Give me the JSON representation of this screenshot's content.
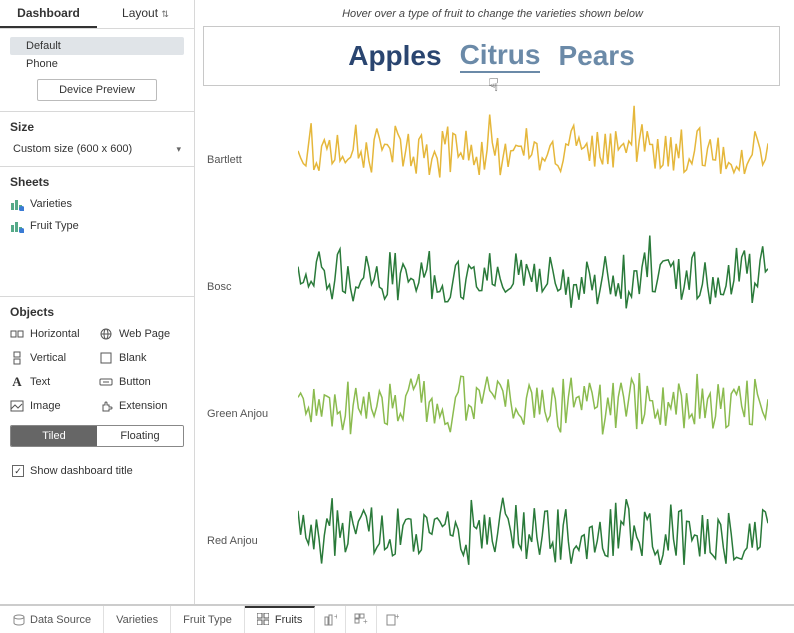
{
  "sidebar": {
    "tabs": {
      "dashboard": "Dashboard",
      "layout": "Layout"
    },
    "devices": [
      "Default",
      "Phone"
    ],
    "device_preview": "Device Preview",
    "size_title": "Size",
    "size_value": "Custom size (600 x 600)",
    "sheets_title": "Sheets",
    "sheets": [
      "Varieties",
      "Fruit Type"
    ],
    "objects_title": "Objects",
    "objects": {
      "horizontal": "Horizontal",
      "vertical": "Vertical",
      "text": "Text",
      "image": "Image",
      "webpage": "Web Page",
      "blank": "Blank",
      "button": "Button",
      "extension": "Extension"
    },
    "tiled": "Tiled",
    "floating": "Floating",
    "show_title": "Show dashboard title"
  },
  "main": {
    "hint": "Hover over a type of fruit to change the varieties shown below",
    "filters": [
      {
        "label": "Apples",
        "color": "#2a4570"
      },
      {
        "label": "Citrus",
        "color": "#6b8aa8",
        "underline": true
      },
      {
        "label": "Pears",
        "color": "#6b8aa8"
      }
    ]
  },
  "chart_data": [
    {
      "type": "line",
      "name": "Bartlett",
      "color": "#e5b73b",
      "n": 180,
      "baseline": 55,
      "amp": 22,
      "seed": 1
    },
    {
      "type": "line",
      "name": "Bosc",
      "color": "#2a7a3a",
      "n": 180,
      "baseline": 55,
      "amp": 25,
      "seed": 2
    },
    {
      "type": "line",
      "name": "Green Anjou",
      "color": "#8bbb4f",
      "n": 180,
      "baseline": 55,
      "amp": 25,
      "seed": 3
    },
    {
      "type": "line",
      "name": "Red Anjou",
      "color": "#2a7a3a",
      "n": 180,
      "baseline": 55,
      "amp": 28,
      "seed": 4
    }
  ],
  "bottom_tabs": {
    "data_source": "Data Source",
    "varieties": "Varieties",
    "fruit_type": "Fruit Type",
    "fruits": "Fruits"
  }
}
